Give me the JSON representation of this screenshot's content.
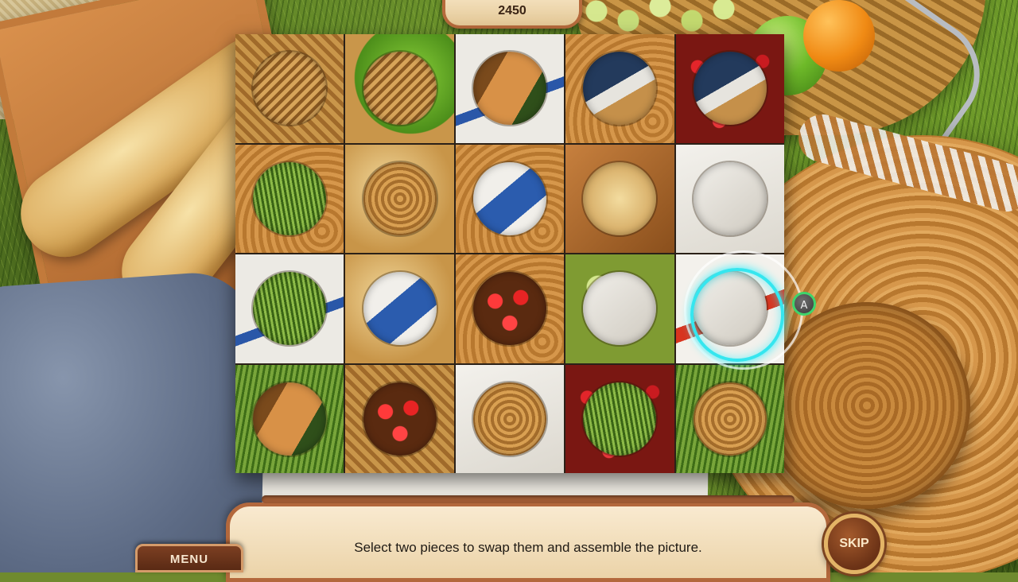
{
  "score": "2450",
  "hint": "Select two pieces to swap them and assemble the picture.",
  "menu_label": "MENU",
  "skip_label": "SKIP",
  "controller_hint": "A",
  "colors": {
    "panel_border": "#b3683c",
    "selection_ring": "#35e6ef",
    "button_ring": "#3fd56b"
  },
  "board": {
    "rows": 4,
    "cols": 5,
    "selected_tile": "r3-c5",
    "tiles": [
      {
        "id": "r1-c1",
        "bg": "t-wicker",
        "hole": "h-wicker"
      },
      {
        "id": "r1-c2",
        "bg": "t-apple",
        "hole": "h-wicker"
      },
      {
        "id": "r1-c3",
        "bg": "t-paperblue",
        "hole": "h-box"
      },
      {
        "id": "r1-c4",
        "bg": "t-hat",
        "hole": "h-dark"
      },
      {
        "id": "r1-c5",
        "bg": "t-berries",
        "hole": "h-dark"
      },
      {
        "id": "r2-c1",
        "bg": "t-hat",
        "hole": "h-grass"
      },
      {
        "id": "r2-c2",
        "bg": "t-bread",
        "hole": "h-hat"
      },
      {
        "id": "r2-c3",
        "bg": "t-hat",
        "hole": "h-paperblue"
      },
      {
        "id": "r2-c4",
        "bg": "t-box",
        "hole": "h-bread"
      },
      {
        "id": "r2-c5",
        "bg": "t-paper",
        "hole": "h-paper"
      },
      {
        "id": "r3-c1",
        "bg": "t-paperblue",
        "hole": "h-grass"
      },
      {
        "id": "r3-c2",
        "bg": "t-bread",
        "hole": "h-paperblue"
      },
      {
        "id": "r3-c3",
        "bg": "t-hat",
        "hole": "h-berries"
      },
      {
        "id": "r3-c4",
        "bg": "t-grapes",
        "hole": "h-paper"
      },
      {
        "id": "r3-c5",
        "bg": "t-red",
        "hole": "h-paper"
      },
      {
        "id": "r4-c1",
        "bg": "t-grass",
        "hole": "h-box"
      },
      {
        "id": "r4-c2",
        "bg": "t-wicker",
        "hole": "h-berries"
      },
      {
        "id": "r4-c3",
        "bg": "t-paper",
        "hole": "h-hat"
      },
      {
        "id": "r4-c4",
        "bg": "t-berries",
        "hole": "h-grass"
      },
      {
        "id": "r4-c5",
        "bg": "t-grass",
        "hole": "h-hat"
      }
    ]
  }
}
